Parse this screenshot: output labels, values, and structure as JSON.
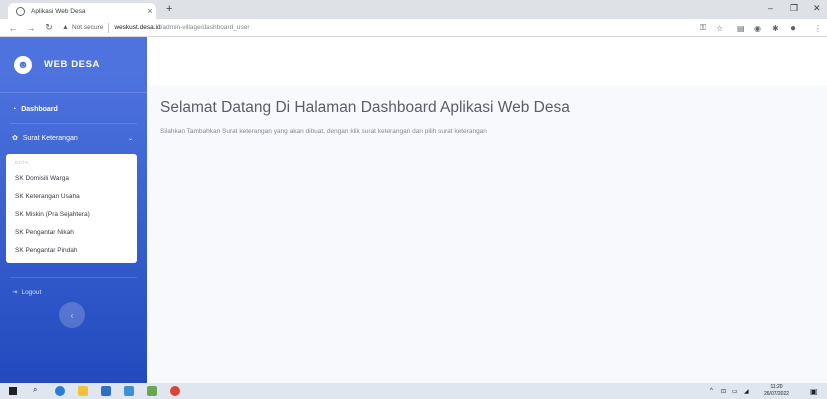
{
  "browser": {
    "tab_title": "Aplikasi Web Desa",
    "tab_close": "×",
    "new_tab": "+",
    "minimize": "–",
    "maximize": "❐",
    "close": "✕",
    "security_label": "Not secure",
    "url_host": "weskust.desa.id",
    "url_path": "/admin-village/dashboard_user"
  },
  "sidebar": {
    "brand": "WEB DESA",
    "dashboard_label": "Dashboard",
    "surat_label": "Surat Keterangan",
    "submenu_header": "DATA:",
    "submenu_items": [
      "SK Domisili Warga",
      "SK Keterangan Usaha",
      "SK Miskin (Pra Sejahtera)",
      "SK Pengantar Nikah",
      "SK Pengantar Pindah"
    ],
    "logout_label": "Logout"
  },
  "main": {
    "title": "Selamat Datang Di Halaman Dashboard Aplikasi Web Desa",
    "subtitle": "Silahkan Tambahkan Surat keterangan yang akan dibuat, dengan klik surat keterangan dan pilih surat keterangan"
  },
  "taskbar": {
    "time": "11:20",
    "date": "26/07/2022"
  },
  "colors": {
    "sidebar_start": "#4e73df",
    "sidebar_end": "#224abe",
    "heading_text": "#5a5c69",
    "body_background": "#f8f9fc"
  },
  "icons": [
    "globe-icon",
    "back-arrow-icon",
    "forward-arrow-icon",
    "reload-icon",
    "warning-icon",
    "key-icon",
    "star-icon",
    "puzzle-icon",
    "profile-icon",
    "smiley-logo-icon",
    "dashboard-icon",
    "gear-icon",
    "chevron-down-icon",
    "logout-icon",
    "chevron-left-icon",
    "windows-start-icon",
    "search-icon"
  ]
}
